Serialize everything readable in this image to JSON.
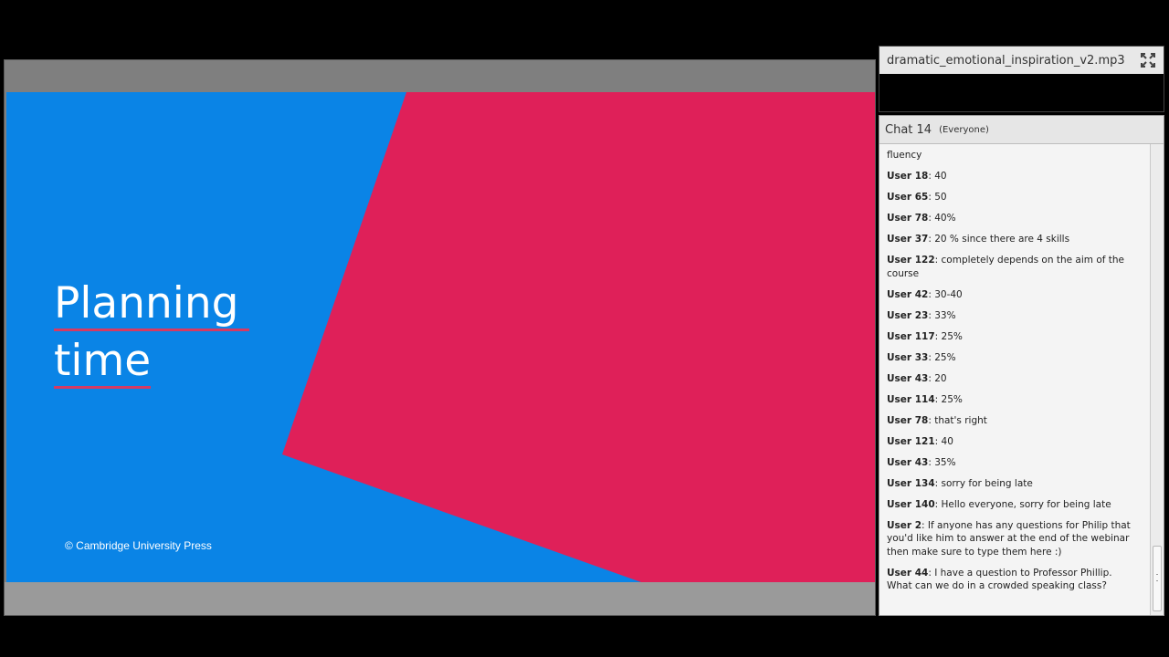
{
  "slide": {
    "title_line1": "Planning",
    "title_line2": "time",
    "copyright": "© Cambridge University Press",
    "colors": {
      "background": "#0a84e6",
      "shape": "#df2059",
      "underline": "#d63a63"
    }
  },
  "music_pod": {
    "filename": "dramatic_emotional_inspiration_v2.mp3",
    "fullscreen_icon": "fullscreen-icon"
  },
  "chat": {
    "title": "Chat 14",
    "audience": "(Everyone)",
    "messages": [
      {
        "user": "",
        "text": "fluency"
      },
      {
        "user": "User 18",
        "text": ": 40"
      },
      {
        "user": "User 65",
        "text": ": 50"
      },
      {
        "user": "User 78",
        "text": ": 40%"
      },
      {
        "user": "User 37",
        "text": ": 20 % since there are 4 skills"
      },
      {
        "user": "User 122",
        "text": ": completely depends on the aim of the course"
      },
      {
        "user": "User 42",
        "text": ": 30-40"
      },
      {
        "user": "User 23",
        "text": ": 33%"
      },
      {
        "user": "User 117",
        "text": ": 25%"
      },
      {
        "user": "User 33",
        "text": ": 25%"
      },
      {
        "user": "User 43",
        "text": ": 20"
      },
      {
        "user": "User 114",
        "text": ": 25%"
      },
      {
        "user": "User 78",
        "text": ": that's right"
      },
      {
        "user": "User 121",
        "text": ": 40"
      },
      {
        "user": "User 43",
        "text": ": 35%"
      },
      {
        "user": "User 134",
        "text": ": sorry for being late"
      },
      {
        "user": "User 140",
        "text": ": Hello everyone, sorry for being late"
      },
      {
        "user": "User 2",
        "text": ": If anyone has any questions for Philip that you'd like him to answer at the end of the webinar then make sure to type them here :)"
      },
      {
        "user": "User 44",
        "text": ": I have a question to Professor Phillip. What can we do in a crowded speaking class?"
      }
    ]
  }
}
